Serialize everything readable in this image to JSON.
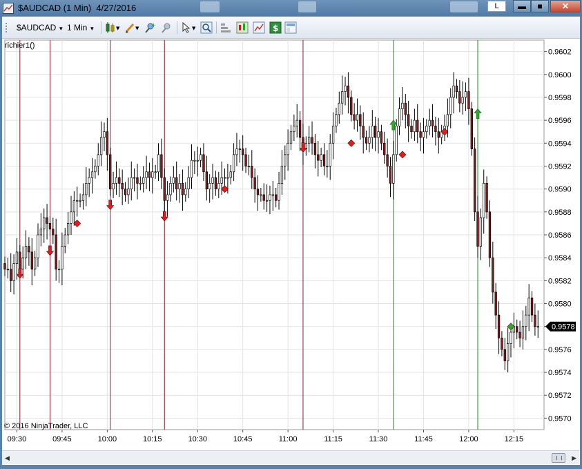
{
  "window": {
    "title": "$AUDCAD (1 Min)  4/27/2016",
    "l_badge": "L",
    "min_glyph": "▬",
    "max_glyph": "■",
    "close_glyph": "✕"
  },
  "toolbar": {
    "instrument": "$AUDCAD",
    "interval": "1 Min",
    "icons": [
      "candlestick-style-icon",
      "pencil-draw-icon",
      "pin-add-icon",
      "pin-remove-icon",
      "cursor-icon",
      "zoom-icon",
      "data-box-icon",
      "bar-style-icon",
      "chart-properties-icon",
      "strategy-dollar-icon",
      "panels-icon"
    ]
  },
  "indicator_label": "richier1()",
  "copyright": "© 2016 NinjaTrader, LLC",
  "colors": {
    "up_candle": "#ffffff",
    "down_candle": "#8b1a1a",
    "candle_outline": "#000000",
    "red_line": "#8b1a2a",
    "green_line": "#1e8a1e",
    "sell_marker": "#e01b1b",
    "buy_marker": "#2ea82e",
    "grid": "#e3e3e3",
    "price_marker_bg": "#000000"
  },
  "chart_data": {
    "type": "candlestick",
    "symbol": "$AUDCAD",
    "interval": "1 Min",
    "date": "4/27/2016",
    "ylim": [
      0.9569,
      0.9603
    ],
    "y_ticks": [
      "0.9570",
      "0.9572",
      "0.9574",
      "0.9576",
      "0.9578",
      "0.9580",
      "0.9582",
      "0.9584",
      "0.9586",
      "0.9588",
      "0.9590",
      "0.9592",
      "0.9594",
      "0.9596",
      "0.9598",
      "0.9600",
      "0.9602"
    ],
    "x_range_minutes": [
      566,
      745
    ],
    "x_ticks": [
      {
        "label": "09:30",
        "minute": 570
      },
      {
        "label": "09:45",
        "minute": 585
      },
      {
        "label": "10:00",
        "minute": 600
      },
      {
        "label": "10:15",
        "minute": 615
      },
      {
        "label": "10:30",
        "minute": 630
      },
      {
        "label": "10:45",
        "minute": 645
      },
      {
        "label": "11:00",
        "minute": 660
      },
      {
        "label": "11:15",
        "minute": 675
      },
      {
        "label": "11:30",
        "minute": 690
      },
      {
        "label": "11:45",
        "minute": 705
      },
      {
        "label": "12:00",
        "minute": 720
      },
      {
        "label": "12:15",
        "minute": 735
      }
    ],
    "last_price": "0.9578",
    "last_price_value": 0.9578,
    "red_vertical_lines_minutes": [
      571,
      581,
      601,
      619,
      665
    ],
    "green_vertical_lines_minutes": [
      695,
      723
    ],
    "sell_arrows": [
      {
        "minute": 571,
        "price": 0.95822
      },
      {
        "minute": 581,
        "price": 0.95842
      },
      {
        "minute": 601,
        "price": 0.95882
      },
      {
        "minute": 619,
        "price": 0.95872
      },
      {
        "minute": 665,
        "price": 0.95932
      }
    ],
    "buy_arrows": [
      {
        "minute": 695,
        "price": 0.9596
      },
      {
        "minute": 723,
        "price": 0.9597
      }
    ],
    "sell_diamonds": [
      {
        "minute": 590,
        "price": 0.9587
      },
      {
        "minute": 639,
        "price": 0.959
      },
      {
        "minute": 681,
        "price": 0.9594
      },
      {
        "minute": 698,
        "price": 0.9593
      },
      {
        "minute": 712,
        "price": 0.9595
      }
    ],
    "buy_diamonds": [
      {
        "minute": 734,
        "price": 0.9578
      }
    ],
    "close_path": [
      [
        566,
        0.9583
      ],
      [
        567,
        0.9583
      ],
      [
        568,
        0.9582
      ],
      [
        569,
        0.95835
      ],
      [
        570,
        0.95845
      ],
      [
        571,
        0.9583
      ],
      [
        572,
        0.9584
      ],
      [
        573,
        0.9585
      ],
      [
        574,
        0.95845
      ],
      [
        575,
        0.9583
      ],
      [
        576,
        0.9584
      ],
      [
        577,
        0.9586
      ],
      [
        578,
        0.95865
      ],
      [
        579,
        0.95875
      ],
      [
        580,
        0.9587
      ],
      [
        581,
        0.95865
      ],
      [
        582,
        0.9586
      ],
      [
        583,
        0.9583
      ],
      [
        584,
        0.9583
      ],
      [
        585,
        0.9585
      ],
      [
        586,
        0.9586
      ],
      [
        587,
        0.9587
      ],
      [
        588,
        0.9588
      ],
      [
        589,
        0.9589
      ],
      [
        590,
        0.9589
      ],
      [
        591,
        0.9589
      ],
      [
        592,
        0.95895
      ],
      [
        593,
        0.95905
      ],
      [
        594,
        0.9591
      ],
      [
        595,
        0.95915
      ],
      [
        596,
        0.9592
      ],
      [
        597,
        0.9593
      ],
      [
        598,
        0.95945
      ],
      [
        599,
        0.9595
      ],
      [
        600,
        0.9593
      ],
      [
        601,
        0.959
      ],
      [
        602,
        0.95905
      ],
      [
        603,
        0.9591
      ],
      [
        604,
        0.95905
      ],
      [
        605,
        0.959
      ],
      [
        606,
        0.95895
      ],
      [
        607,
        0.959
      ],
      [
        608,
        0.9591
      ],
      [
        609,
        0.9591
      ],
      [
        610,
        0.95905
      ],
      [
        611,
        0.95905
      ],
      [
        612,
        0.9591
      ],
      [
        613,
        0.95915
      ],
      [
        614,
        0.9591
      ],
      [
        615,
        0.95915
      ],
      [
        616,
        0.95915
      ],
      [
        617,
        0.9593
      ],
      [
        618,
        0.9591
      ],
      [
        619,
        0.9589
      ],
      [
        620,
        0.95895
      ],
      [
        621,
        0.95905
      ],
      [
        622,
        0.9591
      ],
      [
        623,
        0.959
      ],
      [
        624,
        0.95905
      ],
      [
        625,
        0.95895
      ],
      [
        626,
        0.959
      ],
      [
        627,
        0.9591
      ],
      [
        628,
        0.95925
      ],
      [
        629,
        0.95925
      ],
      [
        630,
        0.95925
      ],
      [
        631,
        0.9593
      ],
      [
        632,
        0.95915
      ],
      [
        633,
        0.959
      ],
      [
        634,
        0.95905
      ],
      [
        635,
        0.9591
      ],
      [
        636,
        0.959
      ],
      [
        637,
        0.95905
      ],
      [
        638,
        0.9591
      ],
      [
        639,
        0.9591
      ],
      [
        640,
        0.9591
      ],
      [
        641,
        0.95915
      ],
      [
        642,
        0.9593
      ],
      [
        643,
        0.95935
      ],
      [
        644,
        0.95935
      ],
      [
        645,
        0.9593
      ],
      [
        646,
        0.9592
      ],
      [
        647,
        0.9592
      ],
      [
        648,
        0.9591
      ],
      [
        649,
        0.959
      ],
      [
        650,
        0.95895
      ],
      [
        651,
        0.95895
      ],
      [
        652,
        0.9589
      ],
      [
        653,
        0.9589
      ],
      [
        654,
        0.95895
      ],
      [
        655,
        0.95895
      ],
      [
        656,
        0.9589
      ],
      [
        657,
        0.95905
      ],
      [
        658,
        0.9592
      ],
      [
        659,
        0.9593
      ],
      [
        660,
        0.9594
      ],
      [
        661,
        0.9595
      ],
      [
        662,
        0.95955
      ],
      [
        663,
        0.9596
      ],
      [
        664,
        0.95945
      ],
      [
        665,
        0.95935
      ],
      [
        666,
        0.9594
      ],
      [
        667,
        0.95945
      ],
      [
        668,
        0.9594
      ],
      [
        669,
        0.9593
      ],
      [
        670,
        0.95925
      ],
      [
        671,
        0.9593
      ],
      [
        672,
        0.9592
      ],
      [
        673,
        0.9592
      ],
      [
        674,
        0.9594
      ],
      [
        675,
        0.95955
      ],
      [
        676,
        0.95965
      ],
      [
        677,
        0.95975
      ],
      [
        678,
        0.95985
      ],
      [
        679,
        0.9599
      ],
      [
        680,
        0.9598
      ],
      [
        681,
        0.95965
      ],
      [
        682,
        0.9596
      ],
      [
        683,
        0.95965
      ],
      [
        684,
        0.95955
      ],
      [
        685,
        0.95945
      ],
      [
        686,
        0.9594
      ],
      [
        687,
        0.95945
      ],
      [
        688,
        0.95955
      ],
      [
        689,
        0.95945
      ],
      [
        690,
        0.9595
      ],
      [
        691,
        0.9594
      ],
      [
        692,
        0.9593
      ],
      [
        693,
        0.9592
      ],
      [
        694,
        0.95905
      ],
      [
        695,
        0.9593
      ],
      [
        696,
        0.95955
      ],
      [
        697,
        0.9597
      ],
      [
        698,
        0.95975
      ],
      [
        699,
        0.95965
      ],
      [
        700,
        0.95955
      ],
      [
        701,
        0.9595
      ],
      [
        702,
        0.9596
      ],
      [
        703,
        0.9595
      ],
      [
        704,
        0.95945
      ],
      [
        705,
        0.9595
      ],
      [
        706,
        0.95955
      ],
      [
        707,
        0.9596
      ],
      [
        708,
        0.95955
      ],
      [
        709,
        0.9595
      ],
      [
        710,
        0.95945
      ],
      [
        711,
        0.9595
      ],
      [
        712,
        0.95955
      ],
      [
        713,
        0.95965
      ],
      [
        714,
        0.9598
      ],
      [
        715,
        0.9599
      ],
      [
        716,
        0.95985
      ],
      [
        717,
        0.95975
      ],
      [
        718,
        0.9598
      ],
      [
        719,
        0.95985
      ],
      [
        720,
        0.9597
      ],
      [
        721,
        0.95935
      ],
      [
        722,
        0.9588
      ],
      [
        723,
        0.9585
      ],
      [
        724,
        0.95875
      ],
      [
        725,
        0.95905
      ],
      [
        726,
        0.9588
      ],
      [
        727,
        0.9584
      ],
      [
        728,
        0.9581
      ],
      [
        729,
        0.9579
      ],
      [
        730,
        0.9577
      ],
      [
        731,
        0.9576
      ],
      [
        732,
        0.9575
      ],
      [
        733,
        0.95765
      ],
      [
        734,
        0.95775
      ],
      [
        735,
        0.9578
      ],
      [
        736,
        0.95775
      ],
      [
        737,
        0.9577
      ],
      [
        738,
        0.9578
      ],
      [
        739,
        0.9579
      ],
      [
        740,
        0.95805
      ],
      [
        741,
        0.9579
      ],
      [
        742,
        0.9578
      ],
      [
        743,
        0.9578
      ]
    ]
  }
}
